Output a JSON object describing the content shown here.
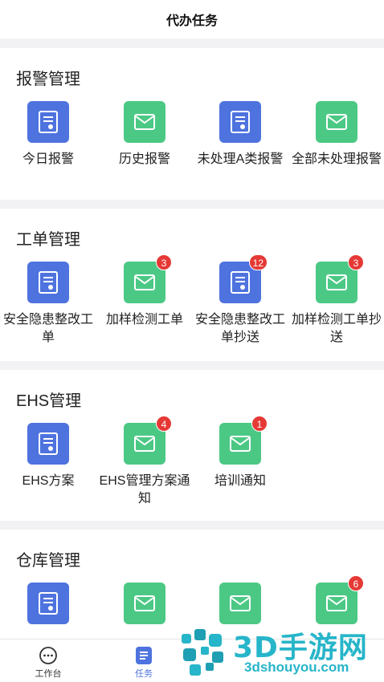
{
  "header": {
    "title": "代办任务"
  },
  "sections": [
    {
      "title": "报警管理",
      "items": [
        {
          "label": "今日报警",
          "icon": "document-icon",
          "color": "blue",
          "badge": ""
        },
        {
          "label": "历史报警",
          "icon": "mail-icon",
          "color": "green",
          "badge": ""
        },
        {
          "label": "未处理A类报警",
          "icon": "document-icon",
          "color": "blue",
          "badge": ""
        },
        {
          "label": "全部未处理报警",
          "icon": "mail-icon",
          "color": "green",
          "badge": ""
        }
      ]
    },
    {
      "title": "工单管理",
      "items": [
        {
          "label": "安全隐患整改工单",
          "icon": "document-icon",
          "color": "blue",
          "badge": ""
        },
        {
          "label": "加样检测工单",
          "icon": "mail-icon",
          "color": "green",
          "badge": "3"
        },
        {
          "label": "安全隐患整改工单抄送",
          "icon": "document-icon",
          "color": "blue",
          "badge": "12"
        },
        {
          "label": "加样检测工单抄送",
          "icon": "mail-icon",
          "color": "green",
          "badge": "3"
        }
      ]
    },
    {
      "title": "EHS管理",
      "items": [
        {
          "label": "EHS方案",
          "icon": "document-icon",
          "color": "blue",
          "badge": ""
        },
        {
          "label": "EHS管理方案通知",
          "icon": "mail-icon",
          "color": "green",
          "badge": "4"
        },
        {
          "label": "培训通知",
          "icon": "mail-icon",
          "color": "green",
          "badge": "1"
        }
      ]
    },
    {
      "title": "仓库管理",
      "items": [
        {
          "label": "",
          "icon": "document-icon",
          "color": "blue",
          "badge": ""
        },
        {
          "label": "",
          "icon": "mail-icon",
          "color": "green",
          "badge": ""
        },
        {
          "label": "",
          "icon": "mail-icon",
          "color": "green",
          "badge": ""
        },
        {
          "label": "",
          "icon": "mail-icon",
          "color": "green",
          "badge": "6"
        }
      ]
    }
  ],
  "tabbar": [
    {
      "label": "工作台",
      "icon": "chat-icon",
      "active": false
    },
    {
      "label": "任务",
      "icon": "task-list-icon",
      "active": true
    }
  ],
  "watermark": {
    "text": "3D手游网",
    "url": "3dshouyou.com"
  },
  "colors": {
    "blue": "#4e73df",
    "green": "#4cc885",
    "badge": "#e53935",
    "accent": "#4e73df"
  }
}
